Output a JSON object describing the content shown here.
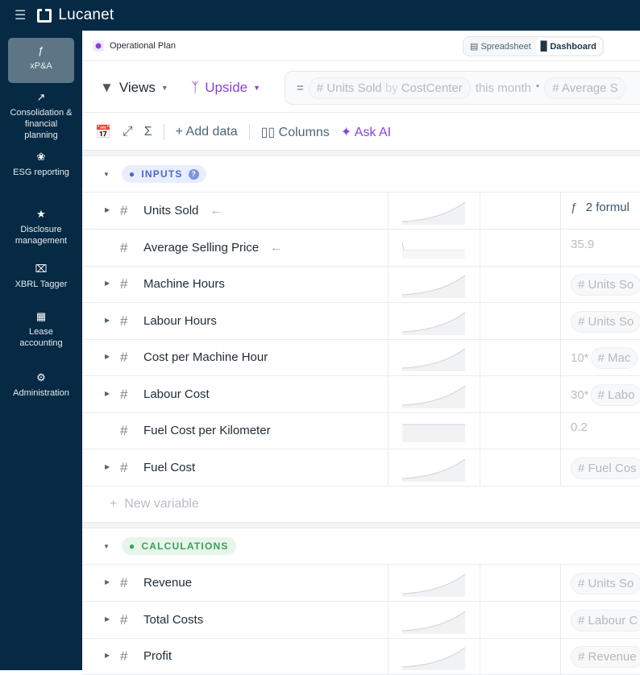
{
  "app": {
    "brand": "Lucanet"
  },
  "sidebar": {
    "items": [
      {
        "label": "xP&A",
        "icon": "fx-circle-icon",
        "active": true
      },
      {
        "label": "Consolidation & financial planning",
        "icon": "chart-up-icon"
      },
      {
        "label": "ESG reporting",
        "icon": "leaf-icon"
      },
      {
        "label": "Disclosure management",
        "icon": "star-comment-icon"
      },
      {
        "label": "XBRL Tagger",
        "icon": "clipboard-x-icon"
      },
      {
        "label": "Lease accounting",
        "icon": "calendar-copy-icon"
      },
      {
        "label": "Administration",
        "icon": "gear-icon"
      }
    ]
  },
  "header": {
    "title": "Operational Plan",
    "view_switch": {
      "spreadsheet": "Spreadsheet",
      "dashboard": "Dashboard",
      "selected": "Dashboard"
    }
  },
  "viewbar": {
    "views": "Views",
    "scenario": "Upside",
    "formula": {
      "eq": "=",
      "var1": "Units Sold",
      "by": "by",
      "dim": "CostCenter",
      "period": "this month",
      "op": "*",
      "var2": "Average S"
    }
  },
  "toolbar": {
    "add_data": "Add data",
    "columns": "Columns",
    "ask_ai": "Ask AI"
  },
  "colors": {
    "dark": "#062a43",
    "purple": "#8b3fd9",
    "inputs": "#4a67d6",
    "calc": "#3aa15a"
  },
  "sections": [
    {
      "label": "INPUTS",
      "rows": [
        {
          "name": "Units Sold",
          "expand": true,
          "arrow": true,
          "spark": "rise",
          "value": "2 formul",
          "fx": true
        },
        {
          "name": "Average Selling Price",
          "expand": false,
          "arrow": true,
          "spark": "drop",
          "value": "35.9"
        },
        {
          "name": "Machine Hours",
          "expand": true,
          "spark": "rise",
          "pill": "Units So"
        },
        {
          "name": "Labour Hours",
          "expand": true,
          "spark": "rise",
          "pill": "Units So"
        },
        {
          "name": "Cost per Machine Hour",
          "expand": true,
          "spark": "rise",
          "prefix": "10*",
          "pill": "Mac"
        },
        {
          "name": "Labour Cost",
          "expand": true,
          "spark": "rise",
          "prefix": "30*",
          "pill": "Labo"
        },
        {
          "name": "Fuel Cost per Kilometer",
          "expand": false,
          "spark": "flat",
          "value": "0.2"
        },
        {
          "name": "Fuel Cost",
          "expand": true,
          "spark": "rise",
          "pill": "Fuel Cos"
        }
      ],
      "new_variable": "New variable"
    },
    {
      "label": "CALCULATIONS",
      "rows": [
        {
          "name": "Revenue",
          "expand": true,
          "spark": "rise",
          "pill": "Units So"
        },
        {
          "name": "Total Costs",
          "expand": true,
          "spark": "rise",
          "pill": "Labour C"
        },
        {
          "name": "Profit",
          "expand": true,
          "spark": "rise",
          "pill": "Revenue"
        }
      ]
    }
  ]
}
